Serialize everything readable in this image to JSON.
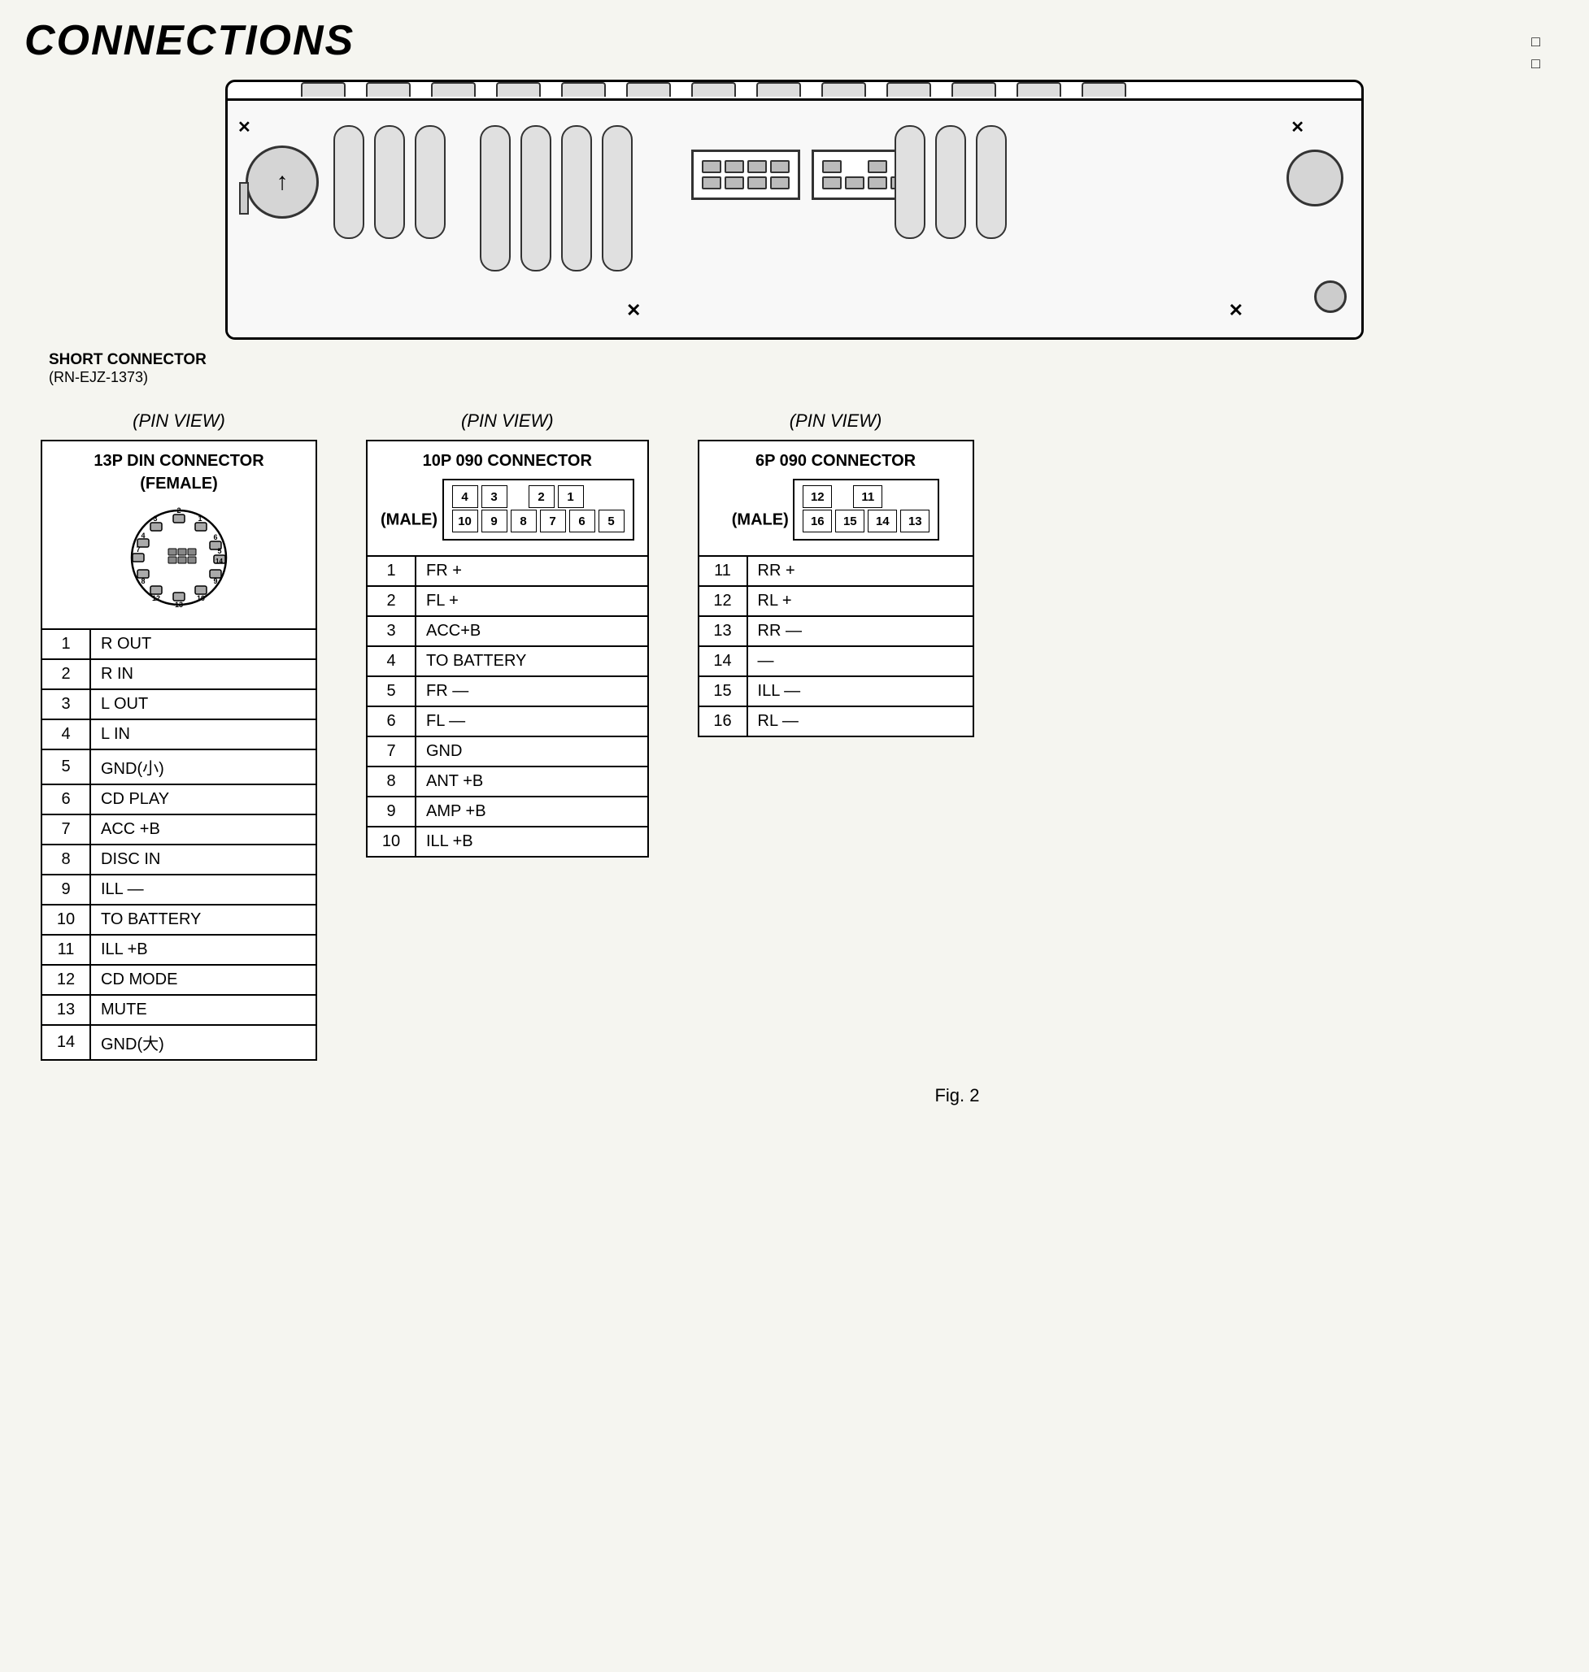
{
  "title": "CONNECTIONS",
  "top_right": {
    "line1": "□",
    "line2": "□"
  },
  "device": {
    "short_connector_label": "SHORT CONNECTOR",
    "short_connector_part": "(RN-EJZ-1373)"
  },
  "sections": [
    {
      "pin_view_label": "(PIN  VIEW)",
      "connector_title": "13P DIN CONNECTOR",
      "connector_subtitle": "(FEMALE)",
      "pins": [
        {
          "num": "1",
          "desc": "R OUT"
        },
        {
          "num": "2",
          "desc": "R IN"
        },
        {
          "num": "3",
          "desc": "L OUT"
        },
        {
          "num": "4",
          "desc": "L IN"
        },
        {
          "num": "5",
          "desc": "GND(小)"
        },
        {
          "num": "6",
          "desc": "CD PLAY"
        },
        {
          "num": "7",
          "desc": "ACC +B"
        },
        {
          "num": "8",
          "desc": "DISC IN"
        },
        {
          "num": "9",
          "desc": "ILL —"
        },
        {
          "num": "10",
          "desc": "TO BATTERY"
        },
        {
          "num": "11",
          "desc": "ILL +B"
        },
        {
          "num": "12",
          "desc": "CD MODE"
        },
        {
          "num": "13",
          "desc": "MUTE"
        },
        {
          "num": "14",
          "desc": "GND(大)"
        }
      ]
    },
    {
      "pin_view_label": "(PIN  VIEW)",
      "connector_title": "10P 090 CONNECTOR",
      "connector_subtitle": "(MALE)",
      "pins": [
        {
          "num": "1",
          "desc": "FR +"
        },
        {
          "num": "2",
          "desc": "FL +"
        },
        {
          "num": "3",
          "desc": "ACC+B"
        },
        {
          "num": "4",
          "desc": "TO BATTERY"
        },
        {
          "num": "5",
          "desc": "FR —"
        },
        {
          "num": "6",
          "desc": "FL —"
        },
        {
          "num": "7",
          "desc": "GND"
        },
        {
          "num": "8",
          "desc": "ANT +B"
        },
        {
          "num": "9",
          "desc": "AMP +B"
        },
        {
          "num": "10",
          "desc": "ILL +B"
        }
      ]
    },
    {
      "pin_view_label": "(PIN  VIEW)",
      "connector_title": "6P 090 CONNECTOR",
      "connector_subtitle": "(MALE)",
      "pins": [
        {
          "num": "11",
          "desc": "RR +"
        },
        {
          "num": "12",
          "desc": "RL +"
        },
        {
          "num": "13",
          "desc": "RR —"
        },
        {
          "num": "14",
          "desc": "—"
        },
        {
          "num": "15",
          "desc": "ILL —"
        },
        {
          "num": "16",
          "desc": "RL —"
        }
      ]
    }
  ],
  "fig_label": "Fig. 2",
  "p10_diagram": {
    "row1": [
      "4",
      "3",
      "",
      "2",
      "1"
    ],
    "row2": [
      "10",
      "9",
      "8",
      "7",
      "6",
      "5"
    ]
  },
  "p6_diagram": {
    "row1": [
      "12",
      "",
      "11"
    ],
    "row2": [
      "16",
      "15",
      "14",
      "13"
    ]
  }
}
